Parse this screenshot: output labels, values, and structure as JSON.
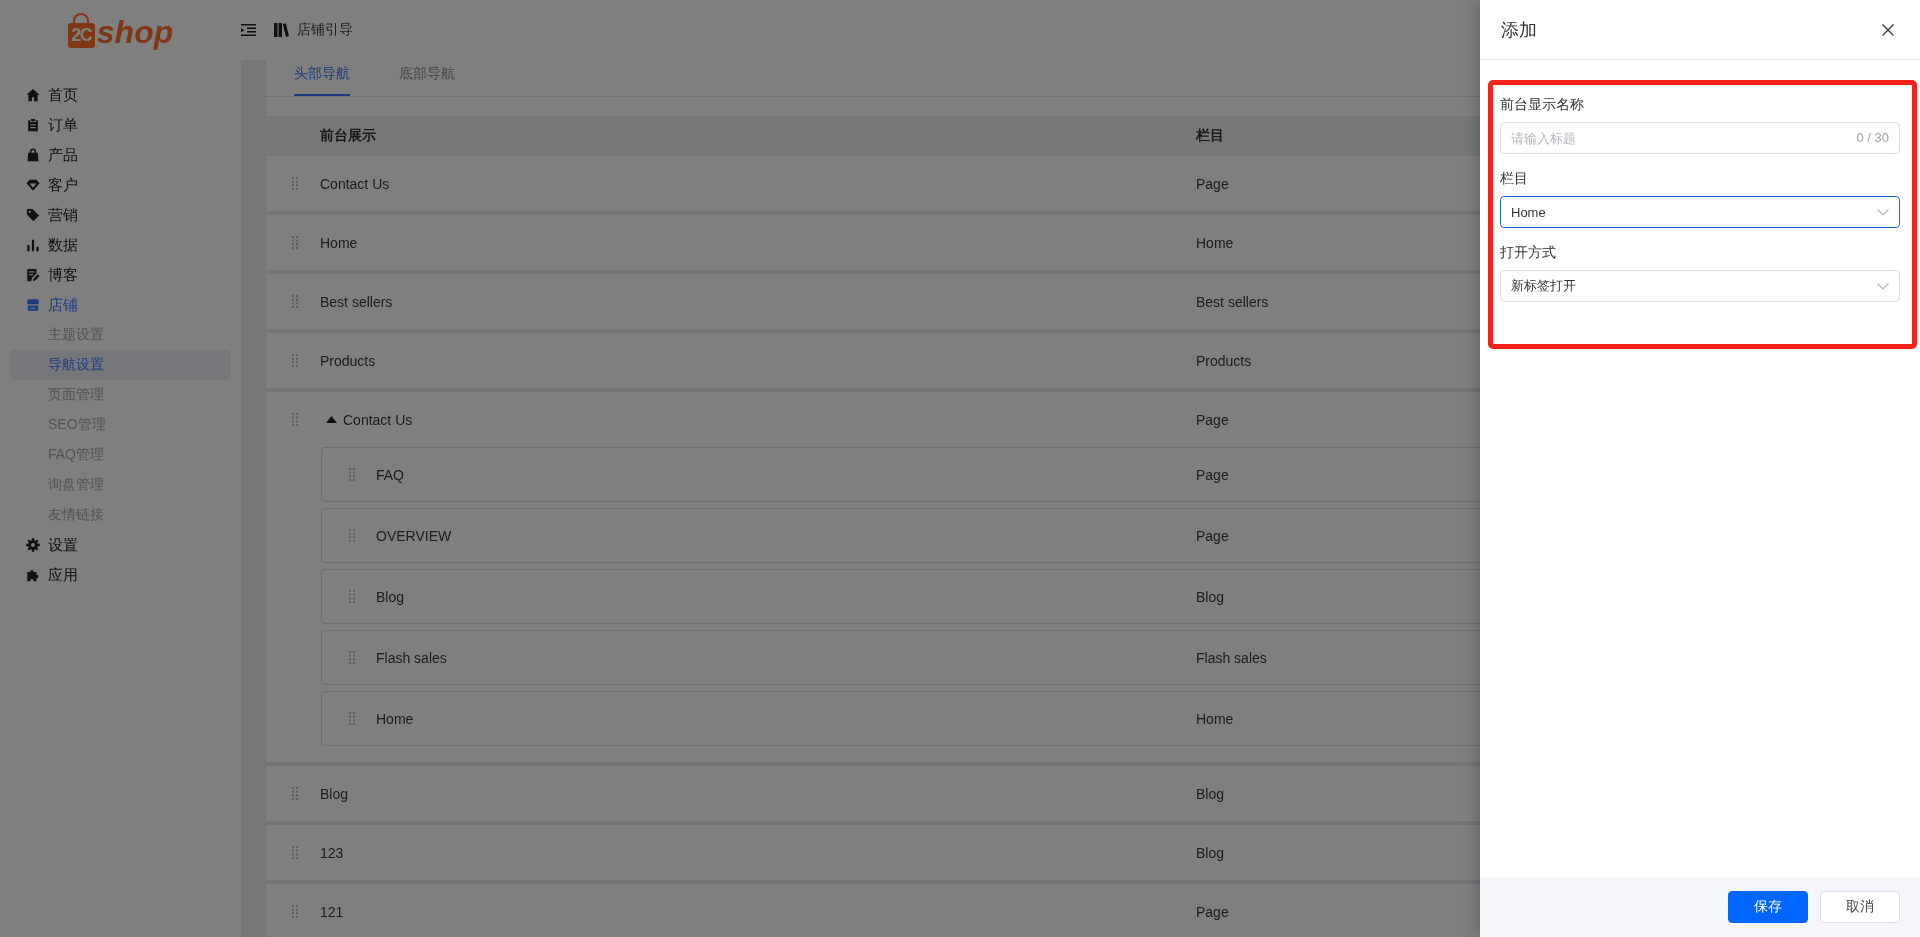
{
  "header": {
    "logo": {
      "mark": "2C",
      "text": "shop"
    },
    "breadcrumb": "店铺引导"
  },
  "sidebar": {
    "items": [
      {
        "label": "首页",
        "selected": false
      },
      {
        "label": "订单",
        "selected": false
      },
      {
        "label": "产品",
        "selected": false
      },
      {
        "label": "客户",
        "selected": false
      },
      {
        "label": "营销",
        "selected": false
      },
      {
        "label": "数据",
        "selected": false
      },
      {
        "label": "博客",
        "selected": false
      },
      {
        "label": "店铺",
        "selected": true,
        "children": [
          {
            "label": "主题设置",
            "selected": false
          },
          {
            "label": "导航设置",
            "selected": true
          },
          {
            "label": "页面管理",
            "selected": false
          },
          {
            "label": "SEO管理",
            "selected": false
          },
          {
            "label": "FAQ管理",
            "selected": false
          },
          {
            "label": "询盘管理",
            "selected": false
          },
          {
            "label": "友情链接",
            "selected": false
          }
        ]
      },
      {
        "label": "设置",
        "selected": false
      },
      {
        "label": "应用",
        "selected": false
      }
    ]
  },
  "tabs": [
    {
      "label": "头部导航",
      "selected": true
    },
    {
      "label": "底部导航",
      "selected": false
    }
  ],
  "table": {
    "columns": [
      "前台展示",
      "栏目"
    ],
    "rows": [
      {
        "name": "Contact Us",
        "category": "Page"
      },
      {
        "name": "Home",
        "category": "Home"
      },
      {
        "name": "Best sellers",
        "category": "Best sellers"
      },
      {
        "name": "Products",
        "category": "Products"
      },
      {
        "name": "Contact Us",
        "category": "Page",
        "expanded": true,
        "children": [
          {
            "name": "FAQ",
            "category": "Page"
          },
          {
            "name": "OVERVIEW",
            "category": "Page"
          },
          {
            "name": "Blog",
            "category": "Blog"
          },
          {
            "name": "Flash sales",
            "category": "Flash sales"
          },
          {
            "name": "Home",
            "category": "Home"
          }
        ]
      },
      {
        "name": "Blog",
        "category": "Blog"
      },
      {
        "name": "123",
        "category": "Blog"
      },
      {
        "name": "121",
        "category": "Page"
      }
    ]
  },
  "drawer": {
    "title": "添加",
    "form": {
      "highlighted": true,
      "fields": [
        {
          "kind": "text",
          "label": "前台显示名称",
          "placeholder": "请输入标题",
          "counter": "0 / 30",
          "focused": false
        },
        {
          "kind": "select",
          "label": "栏目",
          "value": "Home",
          "focused": true
        },
        {
          "kind": "select",
          "label": "打开方式",
          "value": "新标签打开",
          "focused": false
        }
      ]
    },
    "buttons": [
      {
        "label": "保存",
        "kind": "primary"
      },
      {
        "label": "取消",
        "kind": "default"
      }
    ]
  }
}
